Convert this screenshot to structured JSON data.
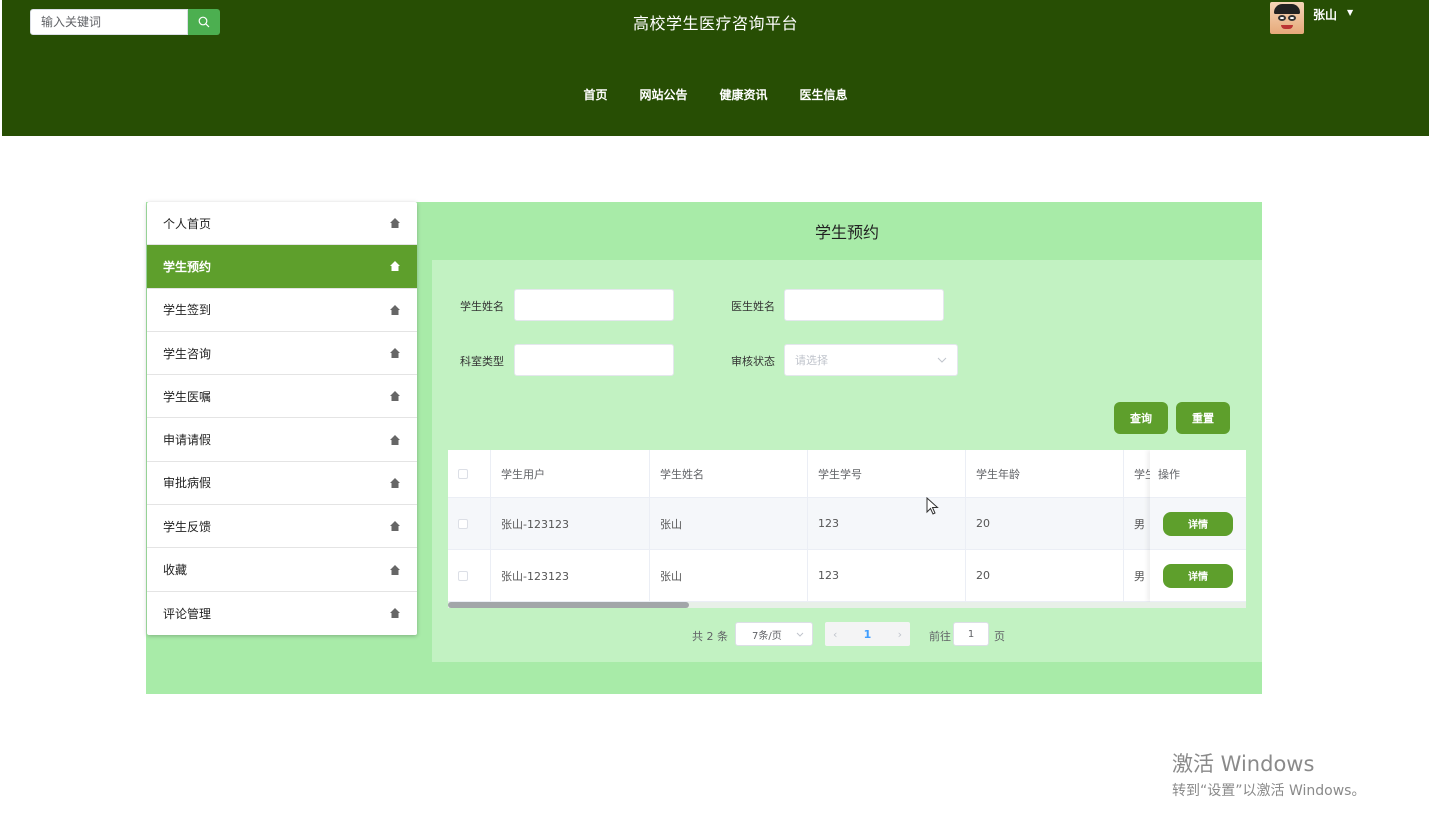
{
  "header": {
    "search_placeholder": "输入关键词",
    "site_title": "高校学生医疗咨询平台",
    "user_name": "张山",
    "nav": [
      "首页",
      "网站公告",
      "健康资讯",
      "医生信息"
    ]
  },
  "sidebar": {
    "items": [
      {
        "label": "个人首页",
        "active": false
      },
      {
        "label": "学生预约",
        "active": true
      },
      {
        "label": "学生签到",
        "active": false
      },
      {
        "label": "学生咨询",
        "active": false
      },
      {
        "label": "学生医嘱",
        "active": false
      },
      {
        "label": "申请请假",
        "active": false
      },
      {
        "label": "审批病假",
        "active": false
      },
      {
        "label": "学生反馈",
        "active": false
      },
      {
        "label": "收藏",
        "active": false
      },
      {
        "label": "评论管理",
        "active": false
      }
    ]
  },
  "page": {
    "title": "学生预约",
    "filters": {
      "student_name_label": "学生姓名",
      "doctor_name_label": "医生姓名",
      "dept_type_label": "科室类型",
      "review_status_label": "审核状态",
      "review_status_placeholder": "请选择"
    },
    "buttons": {
      "search": "查询",
      "reset": "重置"
    }
  },
  "table": {
    "columns": [
      "学生用户",
      "学生姓名",
      "学生学号",
      "学生年龄",
      "学生"
    ],
    "op_header": "操作",
    "rows": [
      {
        "user": "张山-123123",
        "name": "张山",
        "sid": "123",
        "age": "20",
        "gender": "男",
        "action": "详情"
      },
      {
        "user": "张山-123123",
        "name": "张山",
        "sid": "123",
        "age": "20",
        "gender": "男",
        "action": "详情"
      }
    ]
  },
  "pagination": {
    "total": "共 2 条",
    "page_size": "7条/页",
    "current": "1",
    "goto_label": "前往",
    "goto_value": "1",
    "goto_unit": "页"
  },
  "watermark": {
    "line1": "激活 Windows",
    "line2": "转到“设置”以激活 Windows。"
  },
  "colors": {
    "header_bg": "#274e04",
    "accent": "#5e9f2c",
    "panel": "#a8eba8",
    "content": "#c2f2c2"
  }
}
